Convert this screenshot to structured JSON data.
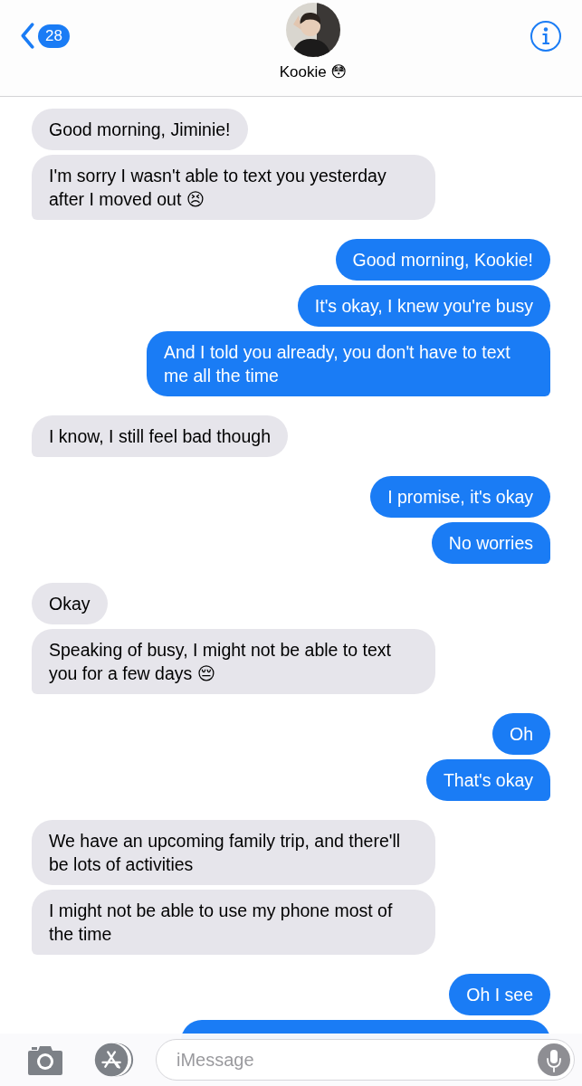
{
  "header": {
    "back_badge": "28",
    "contact_name": "Kookie 😳"
  },
  "groups": [
    {
      "kind": "incoming",
      "messages": [
        {
          "text": "Good morning, Jiminie!"
        },
        {
          "text": "I'm sorry I wasn't able to text you yesterday after I moved out 😣"
        }
      ]
    },
    {
      "kind": "outgoing",
      "messages": [
        {
          "text": "Good morning, Kookie!"
        },
        {
          "text": "It's okay, I knew you're busy"
        },
        {
          "text": "And I told you already, you don't have to text me all the time"
        }
      ]
    },
    {
      "kind": "incoming",
      "messages": [
        {
          "text": "I know, I still feel bad though"
        }
      ]
    },
    {
      "kind": "outgoing",
      "messages": [
        {
          "text": "I promise, it's okay"
        },
        {
          "text": "No worries"
        }
      ]
    },
    {
      "kind": "incoming",
      "messages": [
        {
          "text": "Okay"
        },
        {
          "text": "Speaking of busy, I might not be able to text you for a few days 😔"
        }
      ]
    },
    {
      "kind": "outgoing",
      "messages": [
        {
          "text": "Oh"
        },
        {
          "text": "That's okay"
        }
      ]
    },
    {
      "kind": "incoming",
      "messages": [
        {
          "text": "We have an upcoming family trip, and there'll be lots of activities"
        },
        {
          "text": "I might not be able to use my phone most of the time"
        }
      ]
    },
    {
      "kind": "outgoing",
      "messages": [
        {
          "text": "Oh I see"
        },
        {
          "kind": "hidden"
        }
      ]
    }
  ],
  "composer": {
    "placeholder": "iMessage"
  }
}
